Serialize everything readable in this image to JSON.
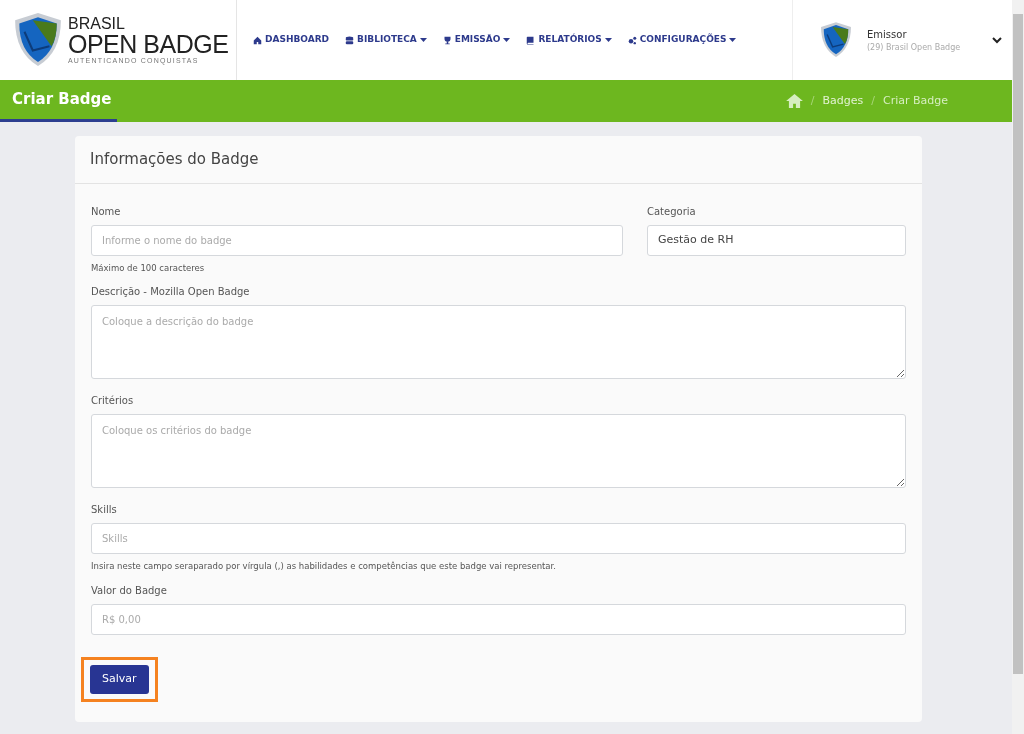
{
  "brand": {
    "line1": "BRASIL",
    "line2": "OPEN BADGE",
    "tagline": "AUTENTICANDO CONQUISTAS"
  },
  "nav": [
    {
      "label": "DASHBOARD",
      "dropdown": false
    },
    {
      "label": "BIBLIOTECA",
      "dropdown": true
    },
    {
      "label": "EMISSÃO",
      "dropdown": true
    },
    {
      "label": "RELATÓRIOS",
      "dropdown": true
    },
    {
      "label": "CONFIGURAÇÕES",
      "dropdown": true
    }
  ],
  "user": {
    "role": "Emissor",
    "org": "(29) Brasil Open Badge"
  },
  "page_title": "Criar Badge",
  "breadcrumb": [
    {
      "kind": "separator",
      "text": "/"
    },
    {
      "kind": "link",
      "text": "Badges"
    },
    {
      "kind": "separator",
      "text": "/"
    },
    {
      "kind": "current",
      "text": "Criar Badge"
    }
  ],
  "card": {
    "title": "Informações do Badge",
    "fields": [
      {
        "kind": "input",
        "label": "Nome",
        "placeholder": "Informe o nome do badge",
        "help": "Máximo de 100 caracteres"
      },
      {
        "kind": "select",
        "label": "Categoria",
        "value": "Gestão de RH"
      },
      {
        "kind": "textarea",
        "label": "Descrição - Mozilla Open Badge",
        "placeholder": "Coloque a descrição do badge"
      },
      {
        "kind": "textarea",
        "label": "Critérios",
        "placeholder": "Coloque os critérios do badge"
      },
      {
        "kind": "input",
        "label": "Skills",
        "placeholder": "Skills",
        "help": "Insira neste campo seraparado por vírgula (,) as habilidades e competências que este badge vai representar."
      },
      {
        "kind": "input",
        "label": "Valor do Badge",
        "placeholder": "R$ 0,00"
      }
    ],
    "button": {
      "label": "Salvar",
      "highlighted": true
    }
  }
}
